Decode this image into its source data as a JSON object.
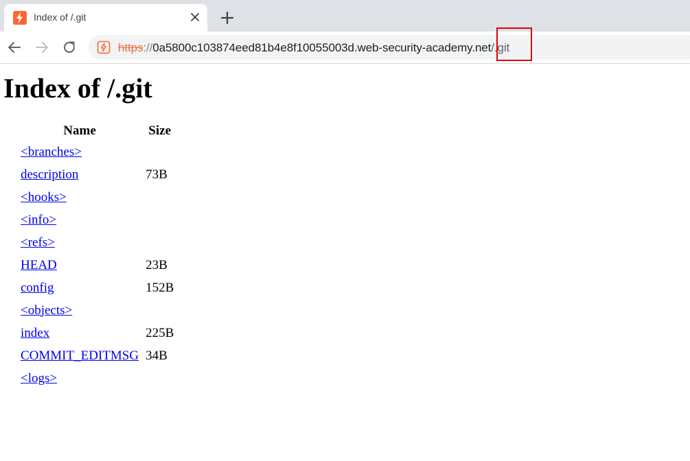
{
  "browser": {
    "tab": {
      "title": "Index of /.git",
      "favicon": "portswigger-lightning-icon",
      "close_icon": "close-icon"
    },
    "new_tab_icon": "plus-icon",
    "nav": {
      "back_icon": "back-arrow-icon",
      "forward_icon": "forward-arrow-icon",
      "reload_icon": "reload-icon"
    },
    "address_bar": {
      "scheme": "https",
      "separator": "://",
      "host": "0a5800c103874eed81b4e8f10055003d.web-security-academy.net",
      "path": "/.git"
    },
    "accent_color": "#ff6633",
    "annotation_color": "#e00000"
  },
  "page": {
    "heading": "Index of /.git",
    "table": {
      "columns": [
        "Name",
        "Size"
      ],
      "rows": [
        {
          "name": "<branches>",
          "size": ""
        },
        {
          "name": "description",
          "size": "73B"
        },
        {
          "name": "<hooks>",
          "size": ""
        },
        {
          "name": "<info>",
          "size": ""
        },
        {
          "name": "<refs>",
          "size": ""
        },
        {
          "name": "HEAD",
          "size": "23B"
        },
        {
          "name": "config",
          "size": "152B"
        },
        {
          "name": "<objects>",
          "size": ""
        },
        {
          "name": "index",
          "size": "225B"
        },
        {
          "name": "COMMIT_EDITMSG",
          "size": "34B"
        },
        {
          "name": "<logs>",
          "size": ""
        }
      ]
    }
  }
}
